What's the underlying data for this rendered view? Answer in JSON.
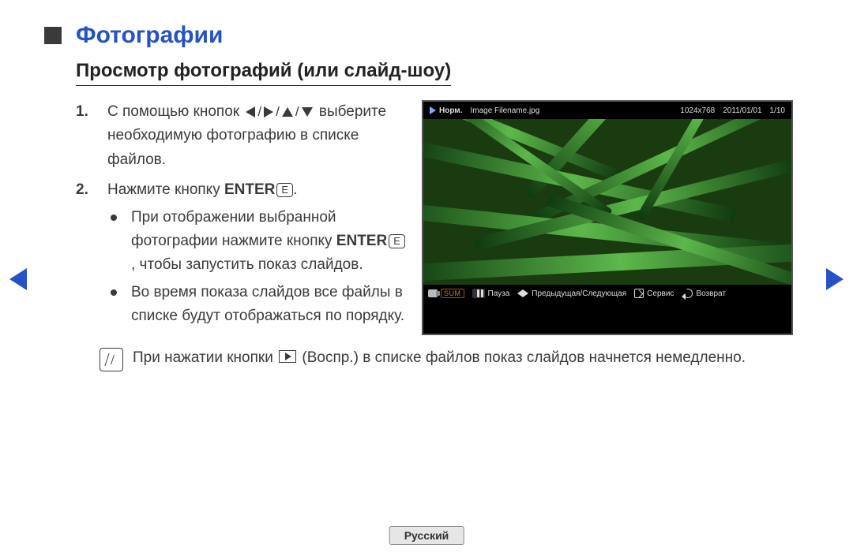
{
  "title": "Фотографии",
  "subtitle": "Просмотр фотографий (или слайд-шоу)",
  "steps": {
    "s1_pre": "С помощью кнопок ",
    "s1_post": " выберите необходимую фотографию в списке файлов.",
    "s2_pre": "Нажмите кнопку ",
    "s2_enter": "ENTER",
    "s2_post": ".",
    "bullets": {
      "b1_pre": "При отображении выбранной фотографии нажмите кнопку ",
      "b1_enter": "ENTER",
      "b1_post": ", чтобы запустить показ слайдов.",
      "b2": "Во время показа слайдов все файлы в списке будут отображаться по порядку."
    }
  },
  "enter_glyph": "E",
  "note": {
    "pre": "При нажатии кнопки ",
    "post": " (Воспр.) в списке файлов показ слайдов начнется немедленно."
  },
  "viewer": {
    "mode": "Норм.",
    "filename": "Image Filename.jpg",
    "resolution": "1024x768",
    "date": "2011/01/01",
    "index": "1/10",
    "sum": "SUM",
    "pause": "Пауза",
    "prevnext": "Предыдущая/Следующая",
    "tools": "Сервис",
    "return": "Возврат"
  },
  "language": "Русский"
}
